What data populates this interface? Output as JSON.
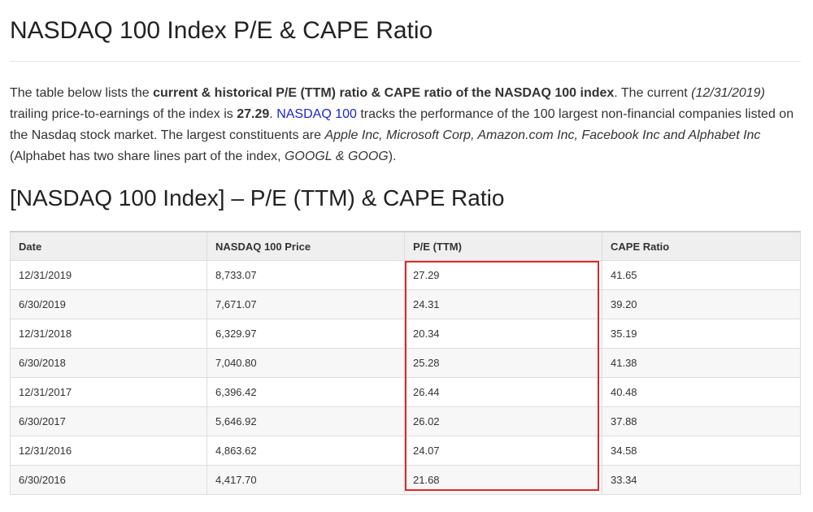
{
  "page": {
    "title": "NASDAQ 100 Index P/E & CAPE Ratio"
  },
  "intro": {
    "p1": "The table below lists the ",
    "bold1": "current & historical P/E (TTM) ratio & CAPE ratio of the NASDAQ 100 index",
    "p2": ". The current ",
    "italic_date": "(12/31/2019)",
    "p3": " trailing price-to-earnings of the index is ",
    "bold_value": "27.29",
    "p4": ". ",
    "link_text": "NASDAQ 100",
    "p5": " tracks the performance of the 100 largest non-financial companies listed on the Nasdaq stock market. The largest constituents are ",
    "italic_companies": "Apple Inc, Microsoft Corp, Amazon.com Inc, Facebook Inc and Alphabet Inc",
    "p6": " (Alphabet has two share lines part of the index, ",
    "italic_tickers": "GOOGL & GOOG",
    "p7": ")."
  },
  "section": {
    "title": "[NASDAQ 100 Index] – P/E (TTM) & CAPE Ratio"
  },
  "table": {
    "headers": [
      "Date",
      "NASDAQ 100 Price",
      "P/E (TTM)",
      "CAPE Ratio"
    ],
    "rows": [
      [
        "12/31/2019",
        "8,733.07",
        "27.29",
        "41.65"
      ],
      [
        "6/30/2019",
        "7,671.07",
        "24.31",
        "39.20"
      ],
      [
        "12/31/2018",
        "6,329.97",
        "20.34",
        "35.19"
      ],
      [
        "6/30/2018",
        "7,040.80",
        "25.28",
        "41.38"
      ],
      [
        "12/31/2017",
        "6,396.42",
        "26.44",
        "40.48"
      ],
      [
        "6/30/2017",
        "5,646.92",
        "26.02",
        "37.88"
      ],
      [
        "12/31/2016",
        "4,863.62",
        "24.07",
        "34.58"
      ],
      [
        "6/30/2016",
        "4,417.70",
        "21.68",
        "33.34"
      ]
    ]
  },
  "colors": {
    "link": "#1a27c9",
    "highlight": "#e0262b"
  }
}
